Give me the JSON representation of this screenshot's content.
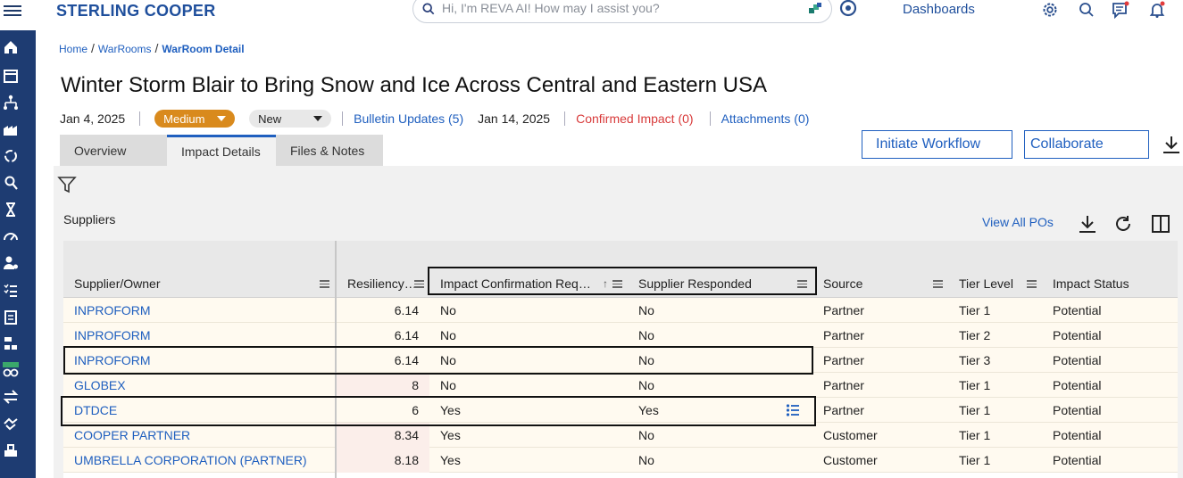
{
  "app": {
    "brand": "STERLING COOPER",
    "search_placeholder": "Hi, I'm REVA AI! How may I assist you?",
    "dashboards_label": "Dashboards"
  },
  "breadcrumb": {
    "items": [
      "Home",
      "WarRooms",
      "WarRoom Detail"
    ]
  },
  "page": {
    "title": "Winter Storm Blair to Bring Snow and Ice Across Central and Eastern USA",
    "date": "Jan 4, 2025",
    "severity": "Medium",
    "status": "New",
    "bulletin_updates": "Bulletin Updates (5)",
    "bulletin_date": "Jan 14, 2025",
    "confirmed_impact": "Confirmed Impact (0)",
    "attachments": "Attachments (0)"
  },
  "tabs": [
    {
      "label": "Overview",
      "active": false
    },
    {
      "label": "Impact Details",
      "active": true
    },
    {
      "label": "Files & Notes",
      "active": false
    }
  ],
  "actions": {
    "initiate_workflow": "Initiate Workflow",
    "collaborate": "Collaborate"
  },
  "suppliers": {
    "section_label": "Suppliers",
    "view_all": "View All POs",
    "columns": [
      "Supplier/Owner",
      "Resiliency…",
      "Impact Confirmation Req…",
      "Supplier Responded",
      "Source",
      "Tier Level",
      "Impact Status"
    ],
    "rows": [
      {
        "supplier": "INPROFORM",
        "resiliency": "6.14",
        "confirmation": "No",
        "responded": "No",
        "source": "Partner",
        "tier": "Tier 1",
        "status": "Potential"
      },
      {
        "supplier": "INPROFORM",
        "resiliency": "6.14",
        "confirmation": "No",
        "responded": "No",
        "source": "Partner",
        "tier": "Tier 2",
        "status": "Potential"
      },
      {
        "supplier": "INPROFORM",
        "resiliency": "6.14",
        "confirmation": "No",
        "responded": "No",
        "source": "Partner",
        "tier": "Tier 3",
        "status": "Potential"
      },
      {
        "supplier": "GLOBEX",
        "resiliency": "8",
        "confirmation": "No",
        "responded": "No",
        "source": "Partner",
        "tier": "Tier 1",
        "status": "Potential"
      },
      {
        "supplier": "DTDCE",
        "resiliency": "6",
        "confirmation": "Yes",
        "responded": "Yes",
        "source": "Partner",
        "tier": "Tier 1",
        "status": "Potential"
      },
      {
        "supplier": "COOPER PARTNER",
        "resiliency": "8.34",
        "confirmation": "Yes",
        "responded": "No",
        "source": "Customer",
        "tier": "Tier 1",
        "status": "Potential"
      },
      {
        "supplier": "UMBRELLA CORPORATION (PARTNER)",
        "resiliency": "8.18",
        "confirmation": "Yes",
        "responded": "No",
        "source": "Customer",
        "tier": "Tier 1",
        "status": "Potential"
      }
    ]
  },
  "colors": {
    "brand": "#1f4f9c",
    "sidenav": "#1e3c72",
    "severity_medium": "#d98a1d",
    "confirmed_impact": "#d83a3a"
  }
}
